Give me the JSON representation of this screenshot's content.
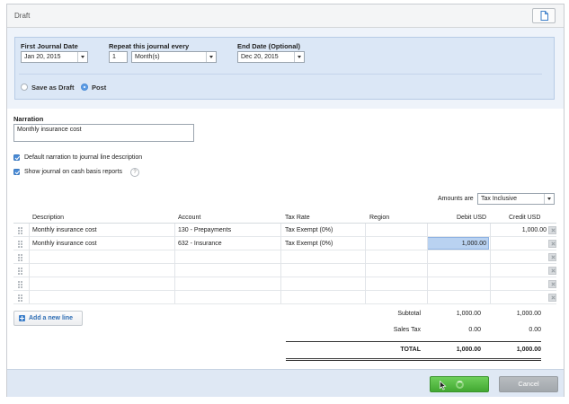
{
  "header": {
    "title": "Draft",
    "icon": "document-icon"
  },
  "repeat": {
    "first_date_label": "First Journal Date",
    "first_date_value": "Jan 20, 2015",
    "repeat_label": "Repeat this journal every",
    "repeat_count": "1",
    "repeat_unit": "Month(s)",
    "end_date_label": "End Date (Optional)",
    "end_date_value": "Dec 20, 2015",
    "save_as_draft_label": "Save as Draft",
    "post_label": "Post",
    "selected": "Post"
  },
  "narration": {
    "label": "Narration",
    "value": "Monthly insurance cost"
  },
  "options": {
    "default_narration_label": "Default narration to journal line description",
    "default_narration_checked": true,
    "cash_basis_label": "Show journal on cash basis reports",
    "cash_basis_checked": true,
    "help_glyph": "?"
  },
  "amounts": {
    "label": "Amounts are",
    "value": "Tax Inclusive"
  },
  "table": {
    "headers": [
      "Description",
      "Account",
      "Tax Rate",
      "Region",
      "Debit USD",
      "Credit USD"
    ],
    "rows": [
      {
        "description": "Monthly insurance cost",
        "account": "130 - Prepayments",
        "tax_rate": "Tax Exempt (0%)",
        "region": "",
        "debit": "",
        "credit": "1,000.00"
      },
      {
        "description": "Monthly insurance cost",
        "account": "632 - Insurance",
        "tax_rate": "Tax Exempt (0%)",
        "region": "",
        "debit": "1,000.00",
        "credit": ""
      }
    ],
    "empty_rows": 4
  },
  "add_line": {
    "label": "Add a new line"
  },
  "totals": {
    "subtotal_label": "Subtotal",
    "subtotal_debit": "1,000.00",
    "subtotal_credit": "1,000.00",
    "tax_label": "Sales Tax",
    "tax_debit": "0.00",
    "tax_credit": "0.00",
    "total_label": "TOTAL",
    "total_debit": "1,000.00",
    "total_credit": "1,000.00"
  },
  "footer": {
    "save_state": "loading",
    "cancel_label": "Cancel"
  },
  "colors": {
    "save": "#42a832",
    "cancel": "#a2a7ac",
    "accent": "#4a8bd6",
    "panel": "#dbe7f6"
  }
}
